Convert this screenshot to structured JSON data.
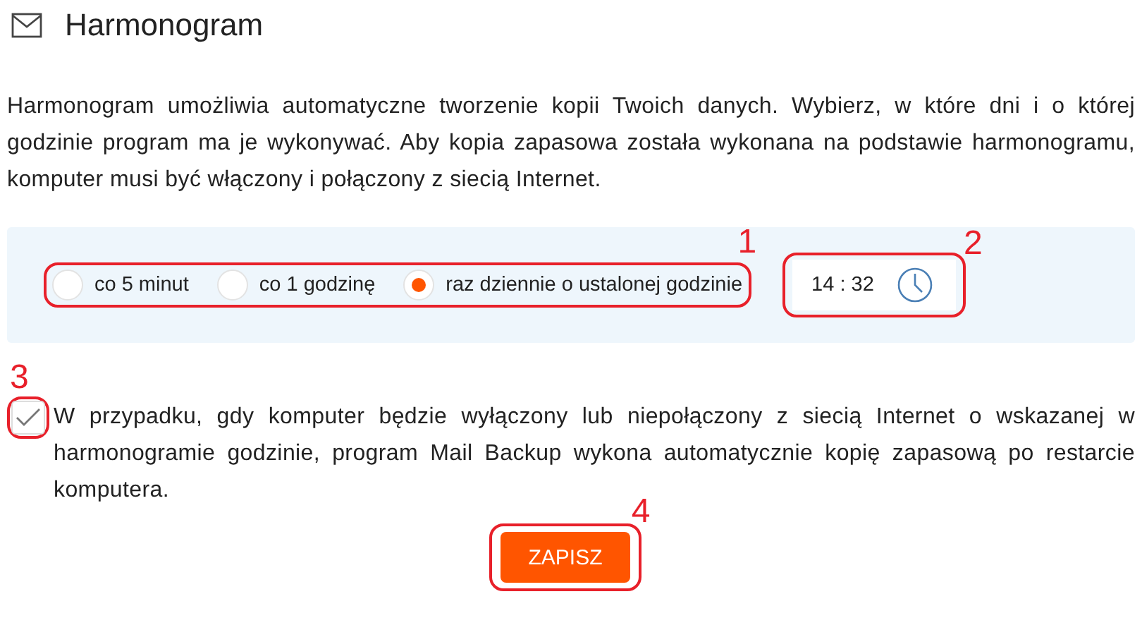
{
  "title": "Harmonogram",
  "description": "Harmonogram umożliwia automatyczne tworzenie kopii Twoich danych. Wybierz, w które dni i o której godzinie program ma je wykonywać. Aby kopia zapasowa została wykonana na podstawie harmonogramu, komputer musi być włączony i połączony z siecią Internet.",
  "schedule": {
    "options": [
      {
        "label": "co 5 minut",
        "selected": false
      },
      {
        "label": "co 1 godzinę",
        "selected": false
      },
      {
        "label": "raz dziennie o ustalonej godzinie",
        "selected": true
      }
    ],
    "time": "14 : 32"
  },
  "restart_option": {
    "checked": true,
    "label": "W przypadku, gdy komputer będzie wyłączony lub niepołączony z siecią Internet o wskazanej w harmonogramie godzinie, program Mail Backup wykona automatycznie kopię zapasową po restarcie komputera."
  },
  "save_button": "ZAPISZ",
  "annotations": [
    {
      "label": "1"
    },
    {
      "label": "2"
    },
    {
      "label": "3"
    },
    {
      "label": "4"
    }
  ]
}
